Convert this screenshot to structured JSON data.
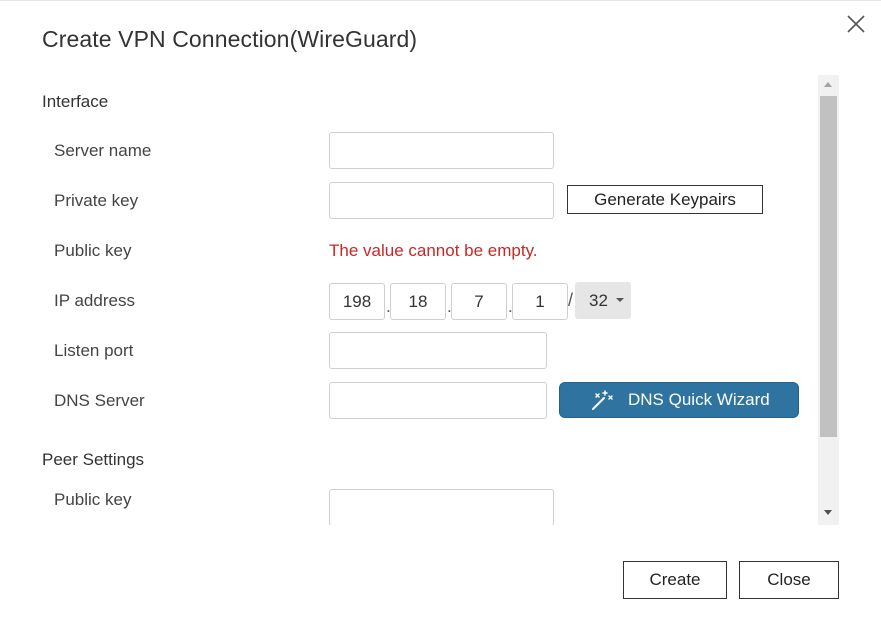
{
  "dialog": {
    "title": "Create VPN Connection(WireGuard)"
  },
  "interface": {
    "heading": "Interface",
    "server_name_label": "Server name",
    "server_name_value": "",
    "private_key_label": "Private key",
    "private_key_value": "",
    "generate_keypairs_label": "Generate Keypairs",
    "public_key_label": "Public key",
    "public_key_error": "The value cannot be empty.",
    "ip_address_label": "IP address",
    "ip_octets": [
      "198",
      "18",
      "7",
      "1"
    ],
    "ip_dot": ".",
    "ip_slash": "/",
    "ip_prefix": "32",
    "listen_port_label": "Listen port",
    "listen_port_value": "",
    "dns_server_label": "DNS Server",
    "dns_server_value": "",
    "dns_wizard_label": "DNS Quick Wizard"
  },
  "peer": {
    "heading": "Peer Settings",
    "public_key_label": "Public key",
    "public_key_value": ""
  },
  "footer": {
    "create_label": "Create",
    "close_label": "Close"
  },
  "icons": {
    "close": "close-icon",
    "wand": "magic-wand-icon",
    "prefix_caret": "caret-down-icon"
  },
  "colors": {
    "accent": "#2f73a0",
    "error": "#c62828"
  }
}
